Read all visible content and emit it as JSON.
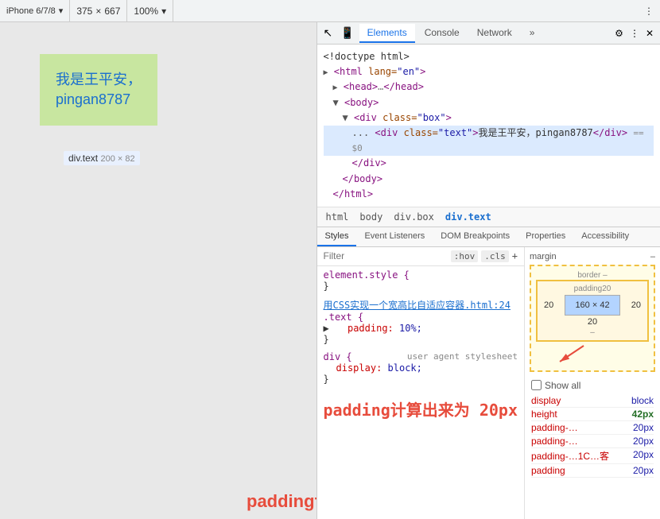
{
  "topbar": {
    "device": "iPhone 6/7/8",
    "width": "375",
    "x": "×",
    "height": "667",
    "zoom": "100%",
    "more_icon": "⋮"
  },
  "devtools_tabs": [
    {
      "label": "Elements",
      "active": true
    },
    {
      "label": "Console",
      "active": false
    },
    {
      "label": "Network",
      "active": false
    },
    {
      "label": "»",
      "active": false
    }
  ],
  "html_source": {
    "line1": "<!doctype html>",
    "line2": "<html lang=\"en\">",
    "line3": "▶ <head>…</head>",
    "line4": "▼ <body>",
    "line5": "▼ <div class=\"box\">",
    "line6_dots": "...",
    "line6": "<div class=\"text\">我是王平安，pingan8787</div>  == $0",
    "line7": "</div>",
    "line8": "</body>",
    "line9": "</html>"
  },
  "breadcrumb": {
    "items": [
      "html",
      "body",
      "div.box",
      "div.text"
    ]
  },
  "style_tabs": [
    "Styles",
    "Event Listeners",
    "DOM Breakpoints",
    "Properties",
    "Accessibility"
  ],
  "filter": {
    "placeholder": "Filter",
    "hov": ":hov",
    "cls": ".cls",
    "plus": "+"
  },
  "css_rules": [
    {
      "selector": "element.style {",
      "properties": [],
      "closing": "}"
    },
    {
      "source": "用CSS实现一个宽高比自适应容器.html:24",
      "selector": ".text {",
      "properties": [
        {
          "name": "padding:",
          "arrow": "▶",
          "value": "10%;"
        }
      ],
      "closing": "}"
    },
    {
      "selector": "div {",
      "source": "user agent stylesheet",
      "properties": [
        {
          "name": "display:",
          "value": "block;"
        }
      ],
      "closing": "}"
    }
  ],
  "box_model": {
    "margin_label": "margin",
    "margin_dash": "–",
    "border_label": "border",
    "border_dash": "–",
    "padding_label": "padding20",
    "left_val": "20",
    "content": "160 × 42",
    "right_val": "20",
    "bottom_val": "20",
    "inner_dash": "–"
  },
  "annotation": {
    "text": "padding计算出来为 20px"
  },
  "computed_props": {
    "show_all": "Show all",
    "props": [
      {
        "name": "display",
        "value": "block",
        "highlight": false
      },
      {
        "name": "height",
        "value": "42px",
        "highlight": true
      },
      {
        "name": "padding-…",
        "value": "20px",
        "highlight": false
      },
      {
        "name": "padding-…",
        "value": "20px",
        "highlight": false
      },
      {
        "name": "padding-…1C…客",
        "value": "20px",
        "highlight": false
      },
      {
        "name": "padding",
        "value": "20px",
        "highlight": false
      }
    ]
  },
  "browser_preview": {
    "text": "我是王平安，\npingan8787",
    "label": "div.text",
    "dimensions": "200 × 82"
  }
}
